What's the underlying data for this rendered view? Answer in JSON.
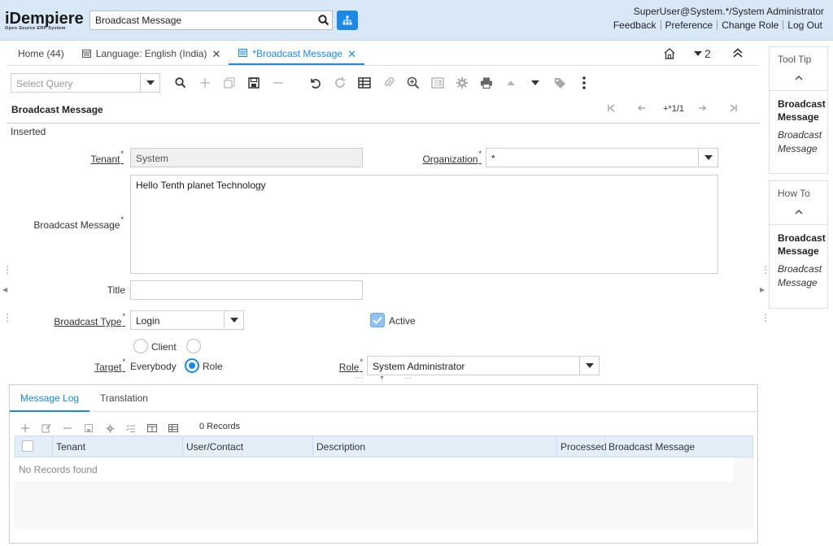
{
  "header": {
    "logo_main": "iDempiere",
    "logo_sub": "Open Source   ERP System",
    "search_value": "Broadcast Message",
    "user": "SuperUser@System.*/System Administrator",
    "links": [
      "Feedback",
      "Preference",
      "Change Role",
      "Log Out"
    ]
  },
  "tabs": [
    {
      "label": "Home (44)"
    },
    {
      "label": "Language: English (India)"
    },
    {
      "label": "*Broadcast Message"
    }
  ],
  "tab_count": "2",
  "toolbar": {
    "query_placeholder": "Select Query"
  },
  "record": {
    "title": "Broadcast Message",
    "nav_position": "+*1/1",
    "status": "Inserted"
  },
  "form": {
    "tenant_label": "Tenant",
    "tenant_value": "System",
    "org_label": "Organization",
    "org_value": "*",
    "message_label": "Broadcast Message",
    "message_value": "Hello Tenth planet Technology",
    "title_label": "Title",
    "title_value": "",
    "type_label": "Broadcast Type",
    "type_value": "Login",
    "active_label": "Active",
    "active_checked": true,
    "client_option": "Client",
    "target_label": "Target",
    "everybody_option": "Everybody",
    "role_option": "Role",
    "role_label": "Role",
    "role_value": "System Administrator",
    "required_mark": "*"
  },
  "side": {
    "tooltip_header": "Tool Tip",
    "tooltip_title": "Broadcast Message",
    "tooltip_text": "Broadcast Message",
    "howto_header": "How To",
    "howto_title": "Broadcast Message",
    "howto_text": "Broadcast Message"
  },
  "detail": {
    "tabs": [
      "Message Log",
      "Translation"
    ],
    "record_count": "0 Records",
    "columns": [
      "Tenant",
      "User/Contact",
      "Description",
      "Processed",
      "Broadcast Message"
    ],
    "empty_text": "No Records found"
  },
  "colors": {
    "accent": "#1e88e5",
    "header_bg": "#d9e8f7"
  }
}
